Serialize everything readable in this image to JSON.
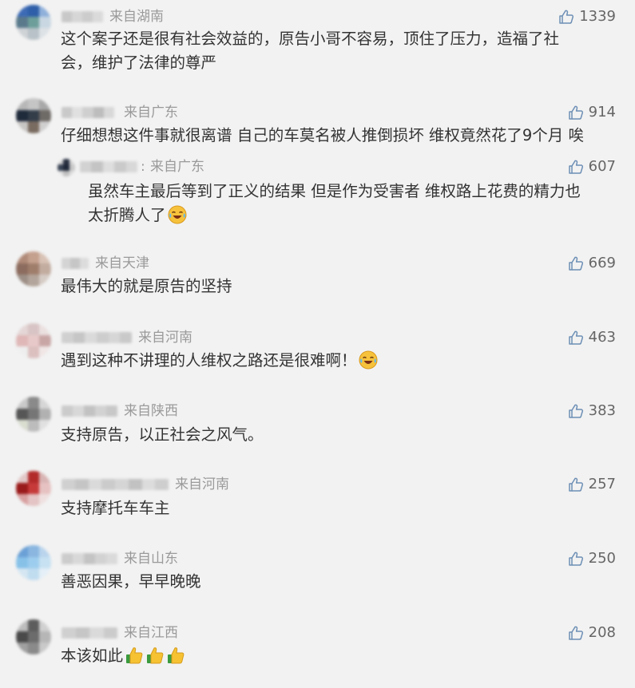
{
  "comments": [
    {
      "location": "来自湖南",
      "likes": "1339",
      "text": "这个案子还是很有社会效益的，原告小哥不容易，顶住了压力，造福了社",
      "text2": "会，维护了法律的尊严"
    },
    {
      "location": "来自广东",
      "likes": "914",
      "text": "仔细想想这件事就很离谱 自己的车莫名被人推倒损坏 维权竟然花了9个月 唉"
    },
    {
      "location": "来自广东",
      "likes": "607",
      "text": "虽然车主最后等到了正义的结果 但是作为受害者 维权路上花费的精力也",
      "text2": "太折腾人了",
      "emoji": "crying-laughing-emoji"
    },
    {
      "location": "来自天津",
      "likes": "669",
      "text": "最伟大的就是原告的坚持"
    },
    {
      "location": "来自河南",
      "likes": "463",
      "text": "遇到这种不讲理的人维权之路还是很难啊！",
      "emoji": "crying-laughing-emoji"
    },
    {
      "location": "来自陕西",
      "likes": "383",
      "text": "支持原告，以正社会之风气。"
    },
    {
      "location": "来自河南",
      "likes": "257",
      "text": "支持摩托车车主"
    },
    {
      "location": "来自山东",
      "likes": "250",
      "text": "善恶因果，早早晚晚"
    },
    {
      "location": "来自江西",
      "likes": "208",
      "text": "本该如此",
      "emoji": "thumbs-up-emoji"
    }
  ],
  "reply_separator": ":",
  "colors": {
    "background": "#f2f2f2",
    "text": "#333333",
    "location": "#9a9a9a",
    "like_icon": "#6d8fb5"
  }
}
